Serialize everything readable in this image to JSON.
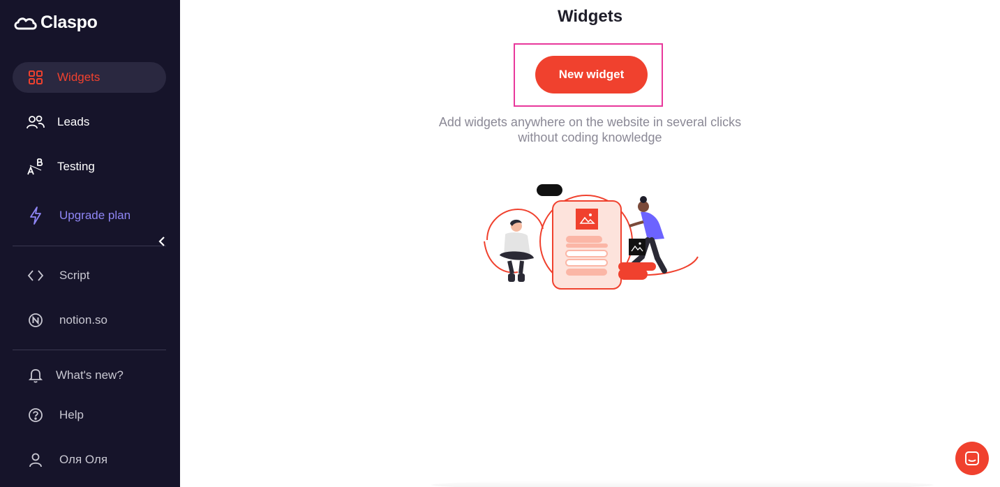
{
  "brand": {
    "name": "Claspo"
  },
  "sidebar": {
    "items": [
      {
        "label": "Widgets",
        "icon": "grid-icon",
        "active": true
      },
      {
        "label": "Leads",
        "icon": "users-icon"
      },
      {
        "label": "Testing",
        "icon": "ab-test-icon"
      },
      {
        "label": "Upgrade plan",
        "icon": "lightning-icon"
      }
    ],
    "site_items": [
      {
        "label": "Script",
        "icon": "code-icon"
      },
      {
        "label": "notion.so",
        "icon": "notion-icon"
      }
    ],
    "footer_items": [
      {
        "label": "What's new?",
        "icon": "bell-icon"
      },
      {
        "label": "Help",
        "icon": "help-icon"
      },
      {
        "label": "Оля Оля",
        "icon": "user-icon"
      }
    ]
  },
  "main": {
    "title": "Widgets",
    "new_widget_label": "New widget",
    "subtitle_line1": "Add widgets anywhere on the website in several clicks",
    "subtitle_line2": "without coding knowledge"
  },
  "colors": {
    "accent": "#f0412e",
    "sidebar_bg": "#16142a",
    "upgrade": "#8f86f5",
    "highlight": "#e8389b"
  }
}
